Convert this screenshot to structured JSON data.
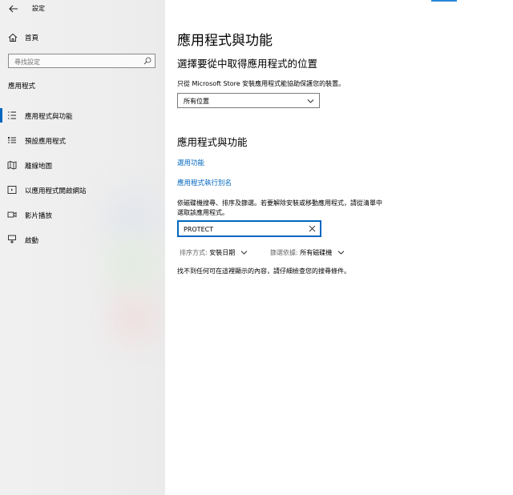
{
  "window": {
    "title": "設定"
  },
  "sidebar": {
    "home_label": "首頁",
    "search_placeholder": "尋找設定",
    "section_title": "應用程式",
    "items": [
      {
        "label": "應用程式與功能",
        "icon": "apps-features-icon",
        "selected": true
      },
      {
        "label": "預設應用程式",
        "icon": "default-apps-icon",
        "selected": false
      },
      {
        "label": "離線地圖",
        "icon": "offline-maps-icon",
        "selected": false
      },
      {
        "label": "以應用程式開啟網站",
        "icon": "apps-for-websites-icon",
        "selected": false
      },
      {
        "label": "影片播放",
        "icon": "video-playback-icon",
        "selected": false
      },
      {
        "label": "啟動",
        "icon": "startup-icon",
        "selected": false
      }
    ]
  },
  "main": {
    "title": "應用程式與功能",
    "source_heading": "選擇要從中取得應用程式的位置",
    "source_desc": "只從 Microsoft Store 安裝應用程式能協助保護您的裝置。",
    "source_value": "所有位置",
    "apps_heading": "應用程式與功能",
    "links": [
      "選用功能",
      "應用程式執行別名"
    ],
    "search_desc_line1": "依磁碟機搜尋、排序及篩選。若要解除安裝或移動應用程式，請從清單中",
    "search_desc_line2": "選取該應用程式。",
    "filter_value": "PROTECT",
    "sort_key": "排序方式:",
    "sort_value": "安裝日期",
    "filter_key": "篩選依據:",
    "filter_by_value": "所有磁碟機",
    "empty_message": "找不到任何可在這裡顯示的內容，請仔細檢查您的搜尋條件。"
  },
  "colors": {
    "accent": "#0067c0",
    "sidebar_bg": "#eeeeee"
  }
}
